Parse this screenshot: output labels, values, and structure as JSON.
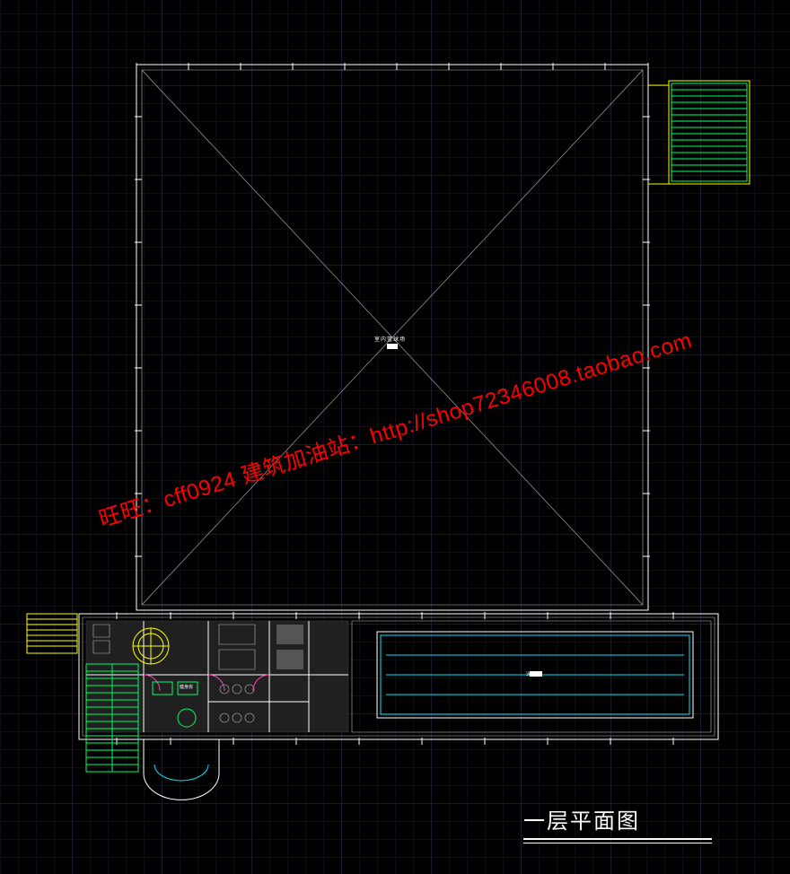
{
  "watermark": "旺旺：cff0924  建筑加油站：http://shop72346008.taobao.com",
  "center_label": "室内篮球场",
  "title": "一层平面图",
  "colors": {
    "bg": "#000000",
    "grid_major": "#1a1a2e",
    "grid_minor": "#0d0d17",
    "primary_line": "#ffffff",
    "cyan": "#00e5ff",
    "yellow": "#ffff00",
    "green": "#00ff66",
    "magenta": "#ff40b0",
    "watermark": "#ff0000"
  },
  "rooms": {
    "gym_label": "健身房",
    "pool_label": "泳池"
  }
}
